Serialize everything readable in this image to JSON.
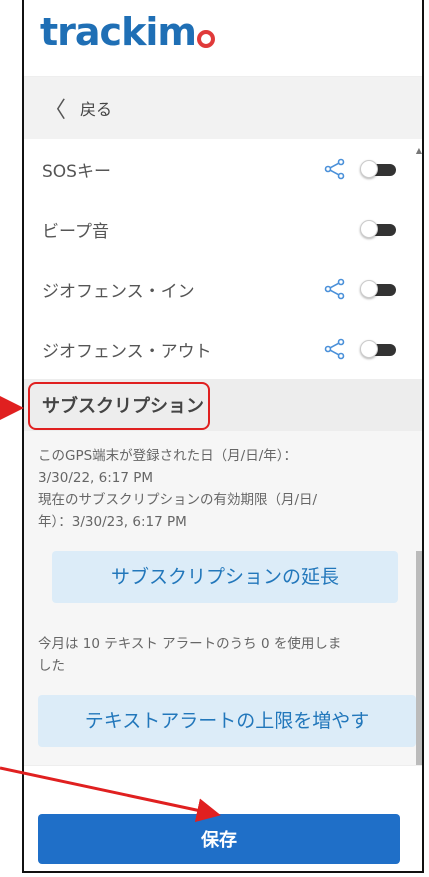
{
  "app": {
    "logo_text": "trackim",
    "brand_color": "#1f6fb5",
    "pin_color": "#e03a3a"
  },
  "nav": {
    "back_label": "戻る"
  },
  "settings": [
    {
      "label": "SOSキー",
      "shareable": true,
      "enabled": false
    },
    {
      "label": "ビープ音",
      "shareable": false,
      "enabled": false
    },
    {
      "label": "ジオフェンス・イン",
      "shareable": true,
      "enabled": false
    },
    {
      "label": "ジオフェンス・アウト",
      "shareable": true,
      "enabled": false
    }
  ],
  "subscription": {
    "title": "サブスクリプション",
    "registered_line1": "このGPS端末が登録された日（月/日/年）：",
    "registered_date": "3/30/22, 6:17 PM",
    "expiry_line1": "現在のサブスクリプションの有効期限（月/日/",
    "expiry_line2": "年）：3/30/23, 6:17 PM",
    "extend_button": "サブスクリプションの延長",
    "usage_line1": "今月は 10 テキスト アラートのうち 0 を使用しま",
    "usage_line2": "した",
    "increase_button": "テキストアラートの上限を増やす"
  },
  "footer": {
    "save_button": "保存",
    "accent": "#1f6fc8"
  },
  "annotation_color": "#e02020"
}
